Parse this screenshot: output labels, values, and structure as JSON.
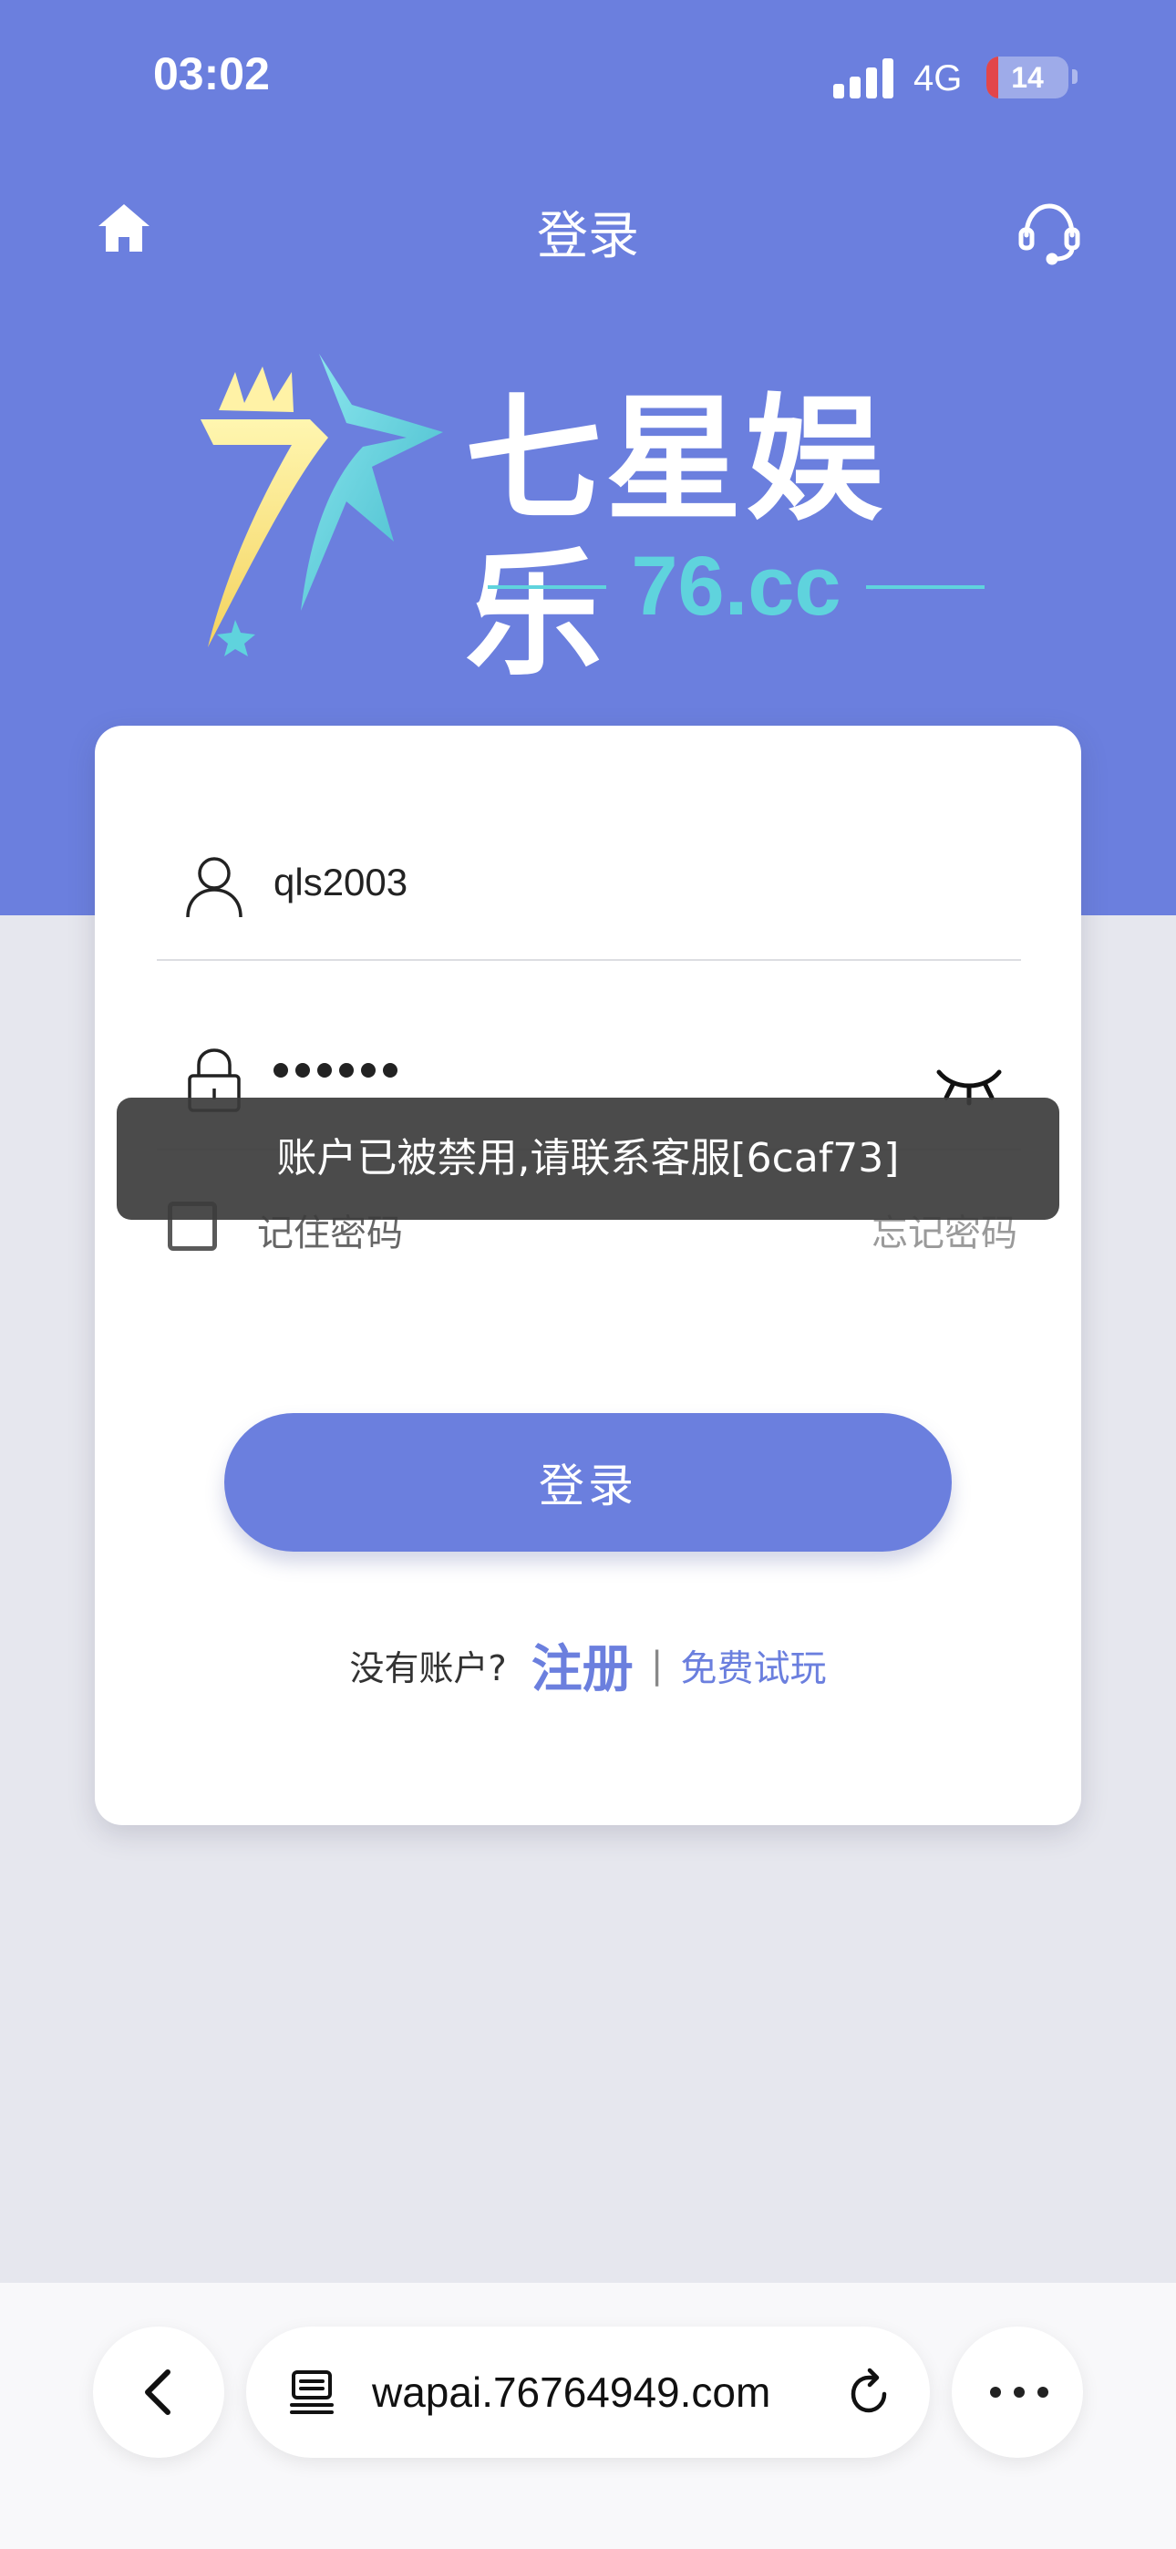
{
  "status_bar": {
    "time": "03:02",
    "network": "4G",
    "battery": "14",
    "battery_level": 0.14
  },
  "header": {
    "title": "登录",
    "home_icon": "home-icon",
    "support_icon": "headset-icon"
  },
  "brand": {
    "name": "七星娱乐",
    "domain": "76.cc"
  },
  "login_form": {
    "username_value": "qls2003",
    "password_mask_count": 6,
    "remember_label": "记住密码",
    "forgot_label": "忘记密码",
    "submit_label": "登录",
    "no_account_text": "没有账户?",
    "register_label": "注册",
    "divider": "|",
    "free_trial_label": "免费试玩"
  },
  "toast": {
    "message": "账户已被禁用,请联系客服[6caf73]"
  },
  "browser": {
    "url": "wapai.76764949.com"
  },
  "colors": {
    "primary": "#6b7fde",
    "accent_cyan": "#5fd3dd",
    "background": "#e6e7ee"
  }
}
